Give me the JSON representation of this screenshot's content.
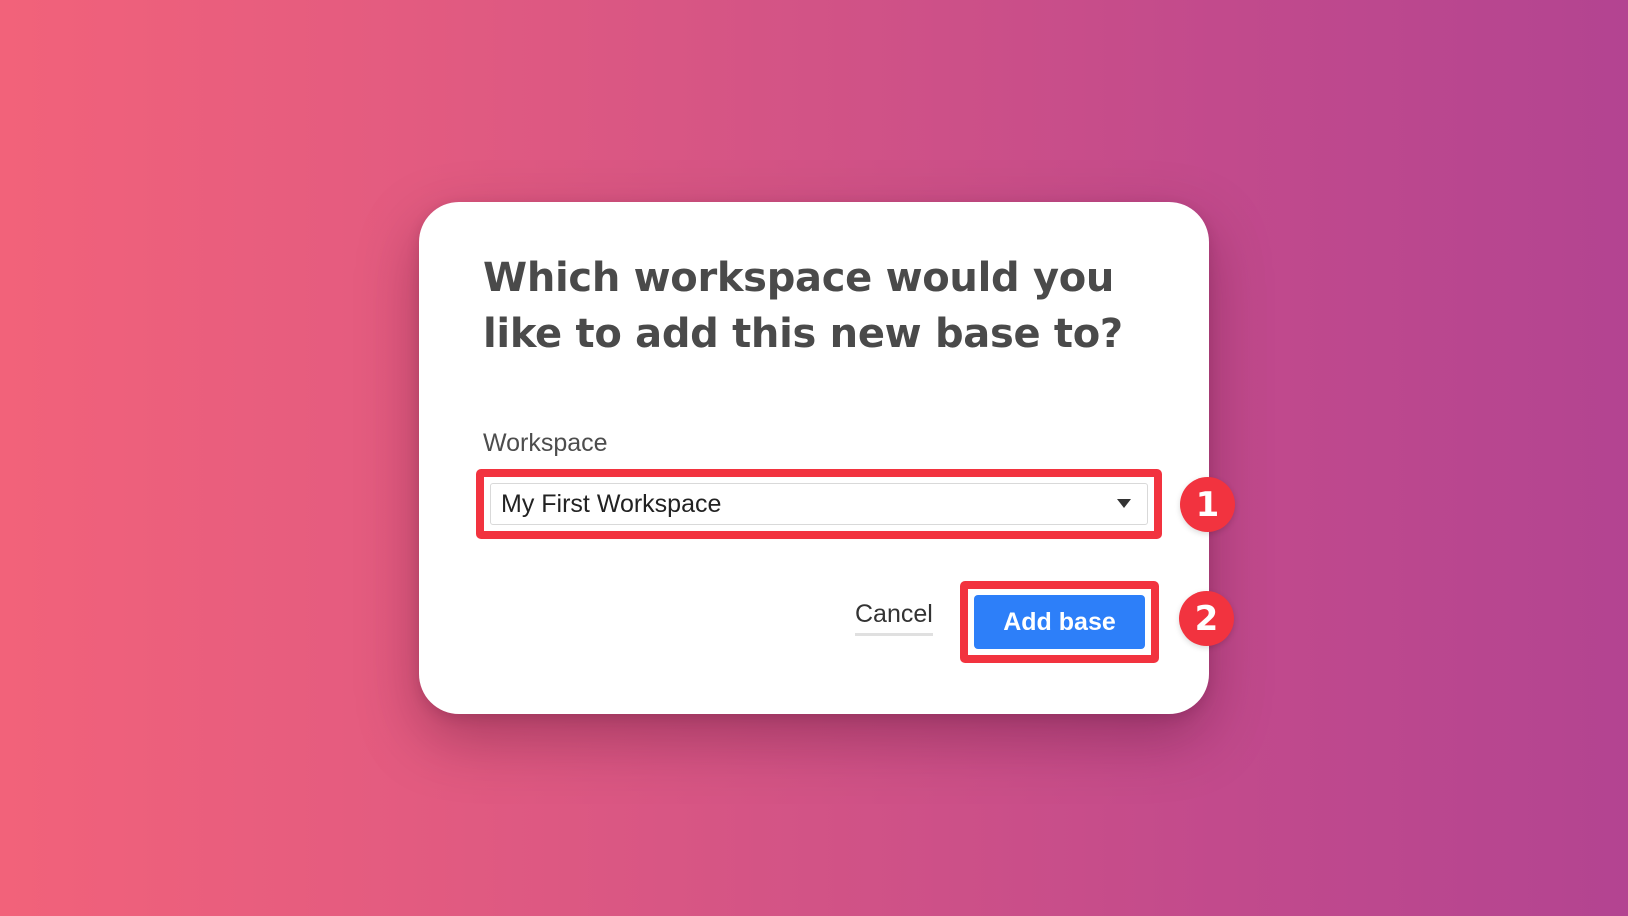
{
  "dialog": {
    "title": "Which workspace would you like to add this new base to?",
    "field_label": "Workspace",
    "select": {
      "value": "My First Workspace",
      "icon": "chevron-down-icon"
    },
    "cancel_label": "Cancel",
    "submit_label": "Add base"
  },
  "annotations": {
    "step_1": "1",
    "step_2": "2"
  },
  "colors": {
    "background_start": "#f2627a",
    "background_end": "#b34491",
    "primary_button": "#2d7ff9",
    "highlight": "#f2333f"
  }
}
